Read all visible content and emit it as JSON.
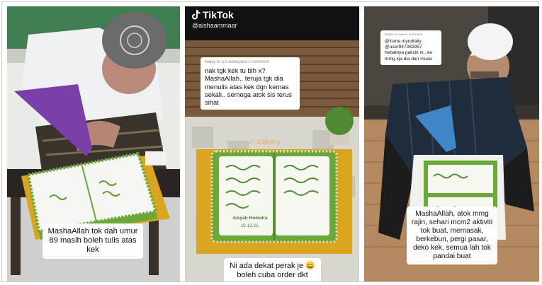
{
  "panel1": {
    "caption": "MashaAllah tok dah umur 89 masih boleh tulis atas kek"
  },
  "panel2": {
    "tiktok_logo": "TikTok",
    "tiktok_user": "@aishaammaar",
    "comment_header": "Reply to a.h.enterprise's comment",
    "comment_text": "nak tgk kek tu blh x? MashaAllah.. teruja tgk dia menulis atas kek dgn kemas sekali.. semoga atok sis terus sihat",
    "cake_date": "10.12.21.",
    "cake_name": "Aisyah Humaira",
    "caption": "Ni ada dekat perak je 😄 boleh cuba order dkt"
  },
  "panel3": {
    "comment_header": "Reply to ••••••'s comment",
    "comment_text": "@lisme.myudtaliy @user947382957 hebatnya pakcik ni...ke mmg kja dia dari muda",
    "caption": "MashaAllah, atok mmg rajin, sehari mcm2 aktiviti tok buat, memasak, berkebun, pergi pasar, deko kek, semua lah tok pandai buat"
  },
  "colors": {
    "frosting_green": "#6aa83a",
    "gold_board": "#d9a520",
    "glove_purple": "#7a3fa8",
    "glove_blue": "#3f86c6"
  }
}
